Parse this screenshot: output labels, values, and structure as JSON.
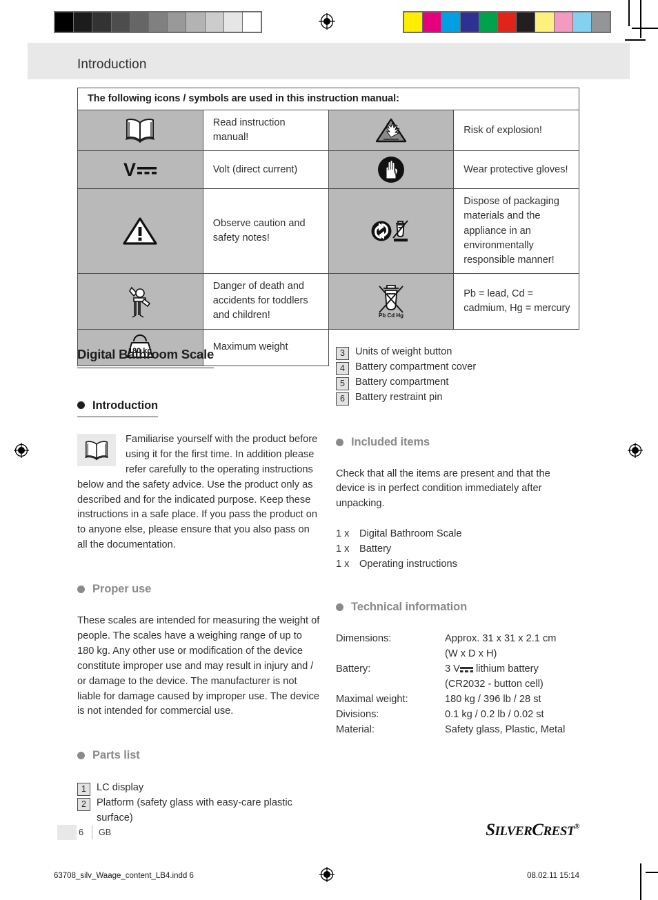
{
  "print_marks": {
    "grayscale_swatches": [
      "#000000",
      "#1c1c1c",
      "#333333",
      "#4d4d4d",
      "#666666",
      "#808080",
      "#999999",
      "#b3b3b3",
      "#cccccc",
      "#e6e6e6",
      "#ffffff"
    ],
    "color_swatches": [
      "#ffed00",
      "#e5007d",
      "#00a0e3",
      "#2e3192",
      "#00a14b",
      "#e2231a",
      "#231f20",
      "#fdf07c",
      "#f49ac1",
      "#84d0f0",
      "#939598"
    ]
  },
  "header": {
    "title": "Introduction"
  },
  "symbol_table": {
    "caption": "The following icons / symbols are used in this instruction manual:",
    "rows": [
      {
        "left_icon": "open-book-icon",
        "left_text": "Read instruction manual!",
        "right_icon": "explosion-risk-icon",
        "right_text": "Risk of explosion!"
      },
      {
        "left_icon": "volt-direct-current-icon",
        "left_text": "Volt (direct current)",
        "right_icon": "protective-gloves-icon",
        "right_text": "Wear protective gloves!"
      },
      {
        "left_icon": "warning-triangle-icon",
        "left_text": "Observe caution and safety notes!",
        "right_icon": "recycling-and-weee-icon",
        "right_text": "Dispose of packaging materials and the appliance in an environmentally responsible manner!"
      },
      {
        "left_icon": "child-danger-icon",
        "left_text": "Danger of death and accidents for toddlers and children!",
        "right_icon": "battery-heavy-metals-icon",
        "right_text": "Pb = lead, Cd = cadmium, Hg = mercury"
      },
      {
        "left_icon": "maximum-weight-icon",
        "left_icon_label": "180 kg",
        "left_text": "Maximum weight",
        "right_icon": null,
        "right_text": null
      }
    ]
  },
  "left_column": {
    "product_title": "Digital Bathroom Scale",
    "introduction": {
      "heading": "Introduction",
      "badge_icon": "open-book-icon",
      "body": "Familiarise yourself with the product before using it for the first time. In addition please refer carefully to the operating instructions below and the safety advice. Use the product only as described and for the indicated purpose. Keep these instructions in a safe place. If you pass the product on to anyone else, please ensure that you also pass on all the documentation."
    },
    "proper_use": {
      "heading": "Proper use",
      "body": "These scales are intended for measuring the weight of people. The scales have a weighing range of up to 180 kg. Any other use or modification of the device constitute improper use and may result in injury and / or damage to the device. The manufacturer is not liable for damage caused by improper use. The device is not intended for commercial use."
    },
    "parts_list": {
      "heading": "Parts list",
      "items": [
        {
          "number": "1",
          "label": "LC display"
        },
        {
          "number": "2",
          "label": "Platform (safety glass with easy-care plastic surface)"
        }
      ]
    }
  },
  "right_column": {
    "parts_list_continued": [
      {
        "number": "3",
        "label": "Units of weight button"
      },
      {
        "number": "4",
        "label": "Battery compartment cover"
      },
      {
        "number": "5",
        "label": "Battery compartment"
      },
      {
        "number": "6",
        "label": "Battery restraint pin"
      }
    ],
    "included_items": {
      "heading": "Included items",
      "body": "Check that all the items are present and that the device is in perfect condition immediately after unpacking.",
      "items": [
        {
          "qty": "1 x",
          "label": "Digital Bathroom Scale"
        },
        {
          "qty": "1 x",
          "label": "Battery"
        },
        {
          "qty": "1 x",
          "label": "Operating instructions"
        }
      ]
    },
    "technical_information": {
      "heading": "Technical information",
      "specs": [
        {
          "key": "Dimensions:",
          "value": "Approx. 31 x 31 x 2.1 cm"
        },
        {
          "key": "",
          "value": "(W x D x H)"
        },
        {
          "key": "Battery:",
          "value_prefix": "3 V",
          "value_suffix": "lithium battery",
          "dc_symbol": true
        },
        {
          "key": "",
          "value": "(CR2032 - button cell)"
        },
        {
          "key": "Maximal weight:",
          "value": "180 kg / 396 lb / 28 st"
        },
        {
          "key": "Divisions:",
          "value": "0.1 kg / 0.2 lb / 0.02 st"
        },
        {
          "key": "Material:",
          "value": "Safety glass, Plastic, Metal"
        }
      ]
    }
  },
  "footer": {
    "page_number": "6",
    "language": "GB",
    "brand_part1": "S",
    "brand_part2": "ILVER",
    "brand_part3": "C",
    "brand_part4": "REST",
    "brand_reg": "®"
  },
  "print_info": {
    "file": "63708_silv_Waage_content_LB4.indd   6",
    "date": "08.02.11   15:14"
  }
}
